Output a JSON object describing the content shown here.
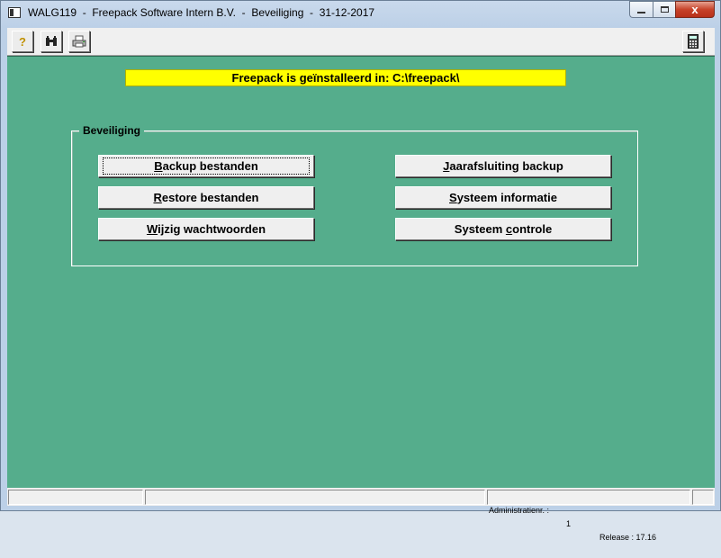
{
  "window": {
    "title": "WALG119  -  Freepack Software Intern B.V.  -  Beveiliging  -  31-12-2017",
    "close_label": "x"
  },
  "toolbar": {
    "help_label": "?",
    "icons": [
      "help-icon",
      "binoculars-icon",
      "printer-icon",
      "calculator-icon"
    ]
  },
  "banner": {
    "text": "Freepack is geïnstalleerd in: C:\\freepack\\"
  },
  "group": {
    "legend": "Beveiliging",
    "buttons": [
      {
        "pre": "",
        "ul": "B",
        "post": "ackup bestanden"
      },
      {
        "pre": "",
        "ul": "R",
        "post": "estore bestanden"
      },
      {
        "pre": "",
        "ul": "W",
        "post": "ijzig wachtwoorden"
      },
      {
        "pre": "",
        "ul": "J",
        "post": "aarafsluiting backup"
      },
      {
        "pre": "",
        "ul": "S",
        "post": "ysteem informatie"
      },
      {
        "pre": "Systeem ",
        "ul": "c",
        "post": "ontrole"
      }
    ]
  },
  "status": {
    "panel1": "",
    "panel2": "",
    "admin_label": "Administratienr. :",
    "admin_value": "1",
    "release": "Release : 17.16"
  },
  "colors": {
    "main_bg": "#55ad8c",
    "banner_bg": "#ffff00"
  }
}
